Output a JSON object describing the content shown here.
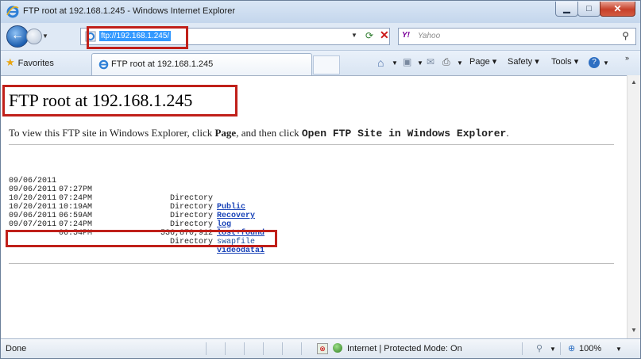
{
  "window": {
    "title": "FTP root at 192.168.1.245 - Windows Internet Explorer",
    "controls": {
      "minimize": "▁",
      "maximize": "□",
      "close": "✕"
    }
  },
  "nav": {
    "url": "ftp://192.168.1.245/",
    "search_provider": "Y!",
    "search_placeholder": "Yahoo"
  },
  "favorites_bar": {
    "favorites_label": "Favorites",
    "tab_label": "FTP root at 192.168.1.245",
    "commands": [
      "Page ▾",
      "Safety ▾",
      "Tools ▾"
    ]
  },
  "page": {
    "heading": "FTP root at 192.168.1.245",
    "info_prefix": "To view this FTP site in Windows Explorer, click ",
    "info_page": "Page",
    "info_middle": ", and then click ",
    "info_action": "Open FTP Site in Windows Explorer",
    "info_suffix": ".",
    "entries": [
      {
        "date": "09/06/2011",
        "time": "07:27PM",
        "kind": "Directory",
        "name": "Public"
      },
      {
        "date": "09/06/2011",
        "time": "07:24PM",
        "kind": "Directory",
        "name": "Recovery"
      },
      {
        "date": "10/20/2011",
        "time": "10:19AM",
        "kind": "Directory",
        "name": "log"
      },
      {
        "date": "10/20/2011",
        "time": "06:59AM",
        "kind": "Directory",
        "name": "lost+found"
      },
      {
        "date": "09/06/2011",
        "time": "07:24PM",
        "kind": "536,870,912",
        "name": "swapfile"
      },
      {
        "date": "09/07/2011",
        "time": "06:54PM",
        "kind": "Directory",
        "name": "videodata1"
      }
    ]
  },
  "status": {
    "left": "Done",
    "zone": "Internet | Protected Mode: On",
    "zoom": "100%"
  },
  "icons": [
    "ie-logo-icon",
    "back-arrow-icon",
    "forward-arrow-icon",
    "refresh-icon",
    "stop-icon",
    "search-icon",
    "favorites-star-icon",
    "home-icon",
    "feeds-icon",
    "mail-icon",
    "print-icon",
    "help-icon",
    "globe-icon",
    "zoom-icon"
  ],
  "colors": {
    "highlight": "#c0201a",
    "link": "#1a44b8",
    "selection": "#3399ff"
  }
}
